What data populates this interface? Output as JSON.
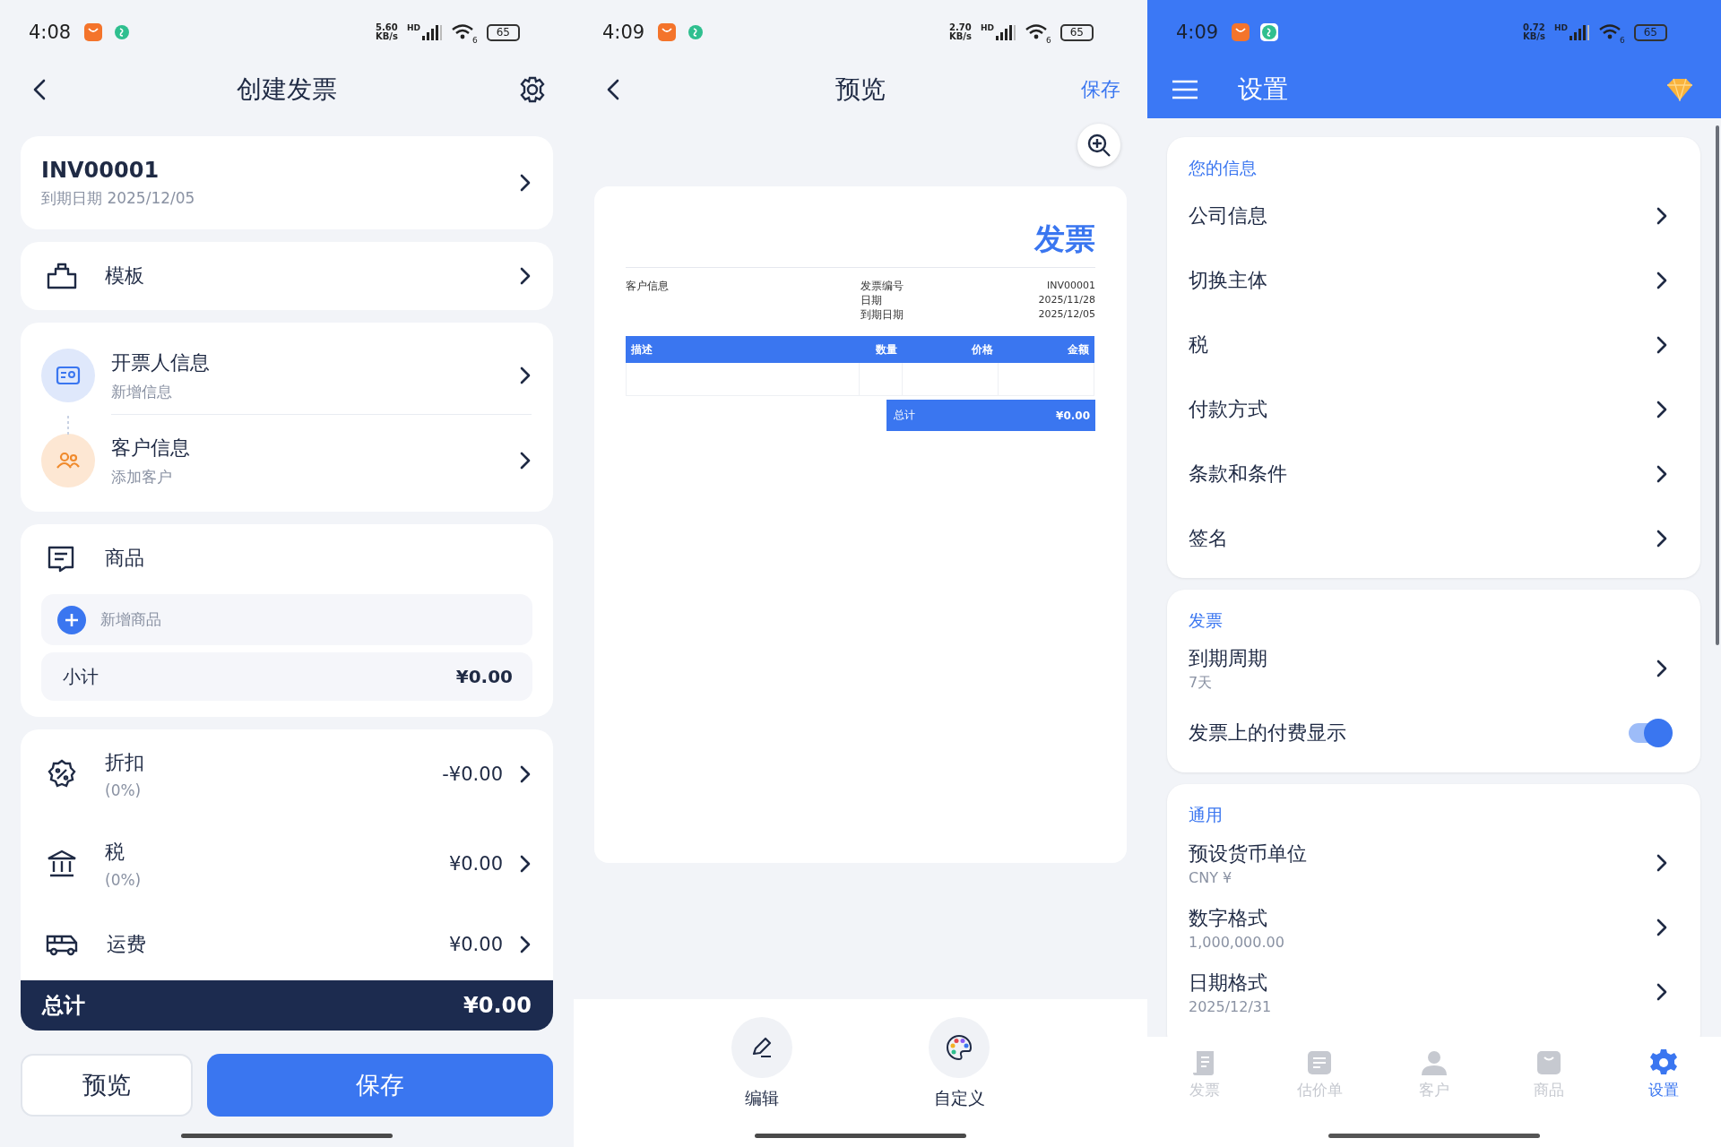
{
  "create_invoice": {
    "status_bar": {
      "time": "4:08",
      "speed": [
        "5.60",
        "KB/s"
      ],
      "network": "HD",
      "wifi": "6",
      "battery": "65"
    },
    "title": "创建发票",
    "invoice": {
      "number": "INV00001",
      "due": "到期日期 2025/12/05"
    },
    "template": {
      "label": "模板"
    },
    "parties": [
      {
        "kind": "issuer",
        "label": "开票人信息",
        "sub": "新增信息"
      },
      {
        "kind": "customer",
        "label": "客户信息",
        "sub": "添加客户"
      }
    ],
    "items": {
      "title": "商品",
      "add_label": "新增商品",
      "subtotal_label": "小计",
      "subtotal": "¥0.00"
    },
    "adjustments": [
      {
        "kind": "discount",
        "label": "折扣",
        "percent": "(0%)",
        "amount": "-¥0.00"
      },
      {
        "kind": "tax",
        "label": "税",
        "percent": "(0%)",
        "amount": "¥0.00"
      },
      {
        "kind": "shipping",
        "label": "运费",
        "amount": "¥0.00"
      }
    ],
    "total": {
      "label": "总计",
      "amount": "¥0.00"
    },
    "buttons": [
      {
        "kind": "secondary",
        "label": "预览"
      },
      {
        "kind": "primary",
        "label": "保存"
      }
    ]
  },
  "preview": {
    "status_bar": {
      "time": "4:09",
      "speed": [
        "2.70",
        "KB/s"
      ],
      "network": "HD",
      "wifi": "6",
      "battery": "65"
    },
    "title": "预览",
    "action": "保存",
    "document": {
      "title": "发票",
      "client_label": "客户信息",
      "meta": [
        {
          "label": "发票编号",
          "value": "INV00001"
        },
        {
          "label": "日期",
          "value": "2025/11/28"
        },
        {
          "label": "到期日期",
          "value": "2025/12/05"
        }
      ],
      "columns": [
        "描述",
        "数量",
        "价格",
        "金额"
      ],
      "total_label": "总计",
      "total": "¥0.00"
    },
    "tools": [
      {
        "kind": "edit",
        "label": "编辑"
      },
      {
        "kind": "palette",
        "label": "自定义"
      }
    ]
  },
  "settings": {
    "status_bar": {
      "time": "4:09",
      "speed": [
        "0.72",
        "KB/s"
      ],
      "network": "HD",
      "wifi": "6",
      "battery": "65"
    },
    "title": "设置",
    "sections": [
      {
        "title": "您的信息",
        "items": [
          {
            "kind": "link",
            "label": "公司信息"
          },
          {
            "kind": "link",
            "label": "切换主体"
          },
          {
            "kind": "link",
            "label": "税"
          },
          {
            "kind": "link",
            "label": "付款方式"
          },
          {
            "kind": "link",
            "label": "条款和条件"
          },
          {
            "kind": "link",
            "label": "签名"
          }
        ]
      },
      {
        "title": "发票",
        "items": [
          {
            "kind": "link",
            "label": "到期周期",
            "value": "7天"
          },
          {
            "kind": "toggle",
            "label": "发票上的付费显示",
            "on": true
          }
        ]
      },
      {
        "title": "通用",
        "items": [
          {
            "kind": "link",
            "label": "预设货币单位",
            "value": "CNY ¥"
          },
          {
            "kind": "link",
            "label": "数字格式",
            "value": "1,000,000.00"
          },
          {
            "kind": "link",
            "label": "日期格式",
            "value": "2025/12/31"
          }
        ]
      }
    ],
    "nav": [
      {
        "kind": "invoice",
        "label": "发票",
        "selected": false
      },
      {
        "kind": "estimate",
        "label": "估价单",
        "selected": false
      },
      {
        "kind": "client",
        "label": "客户",
        "selected": false
      },
      {
        "kind": "product",
        "label": "商品",
        "selected": false
      },
      {
        "kind": "settings",
        "label": "设置",
        "selected": true
      }
    ]
  }
}
